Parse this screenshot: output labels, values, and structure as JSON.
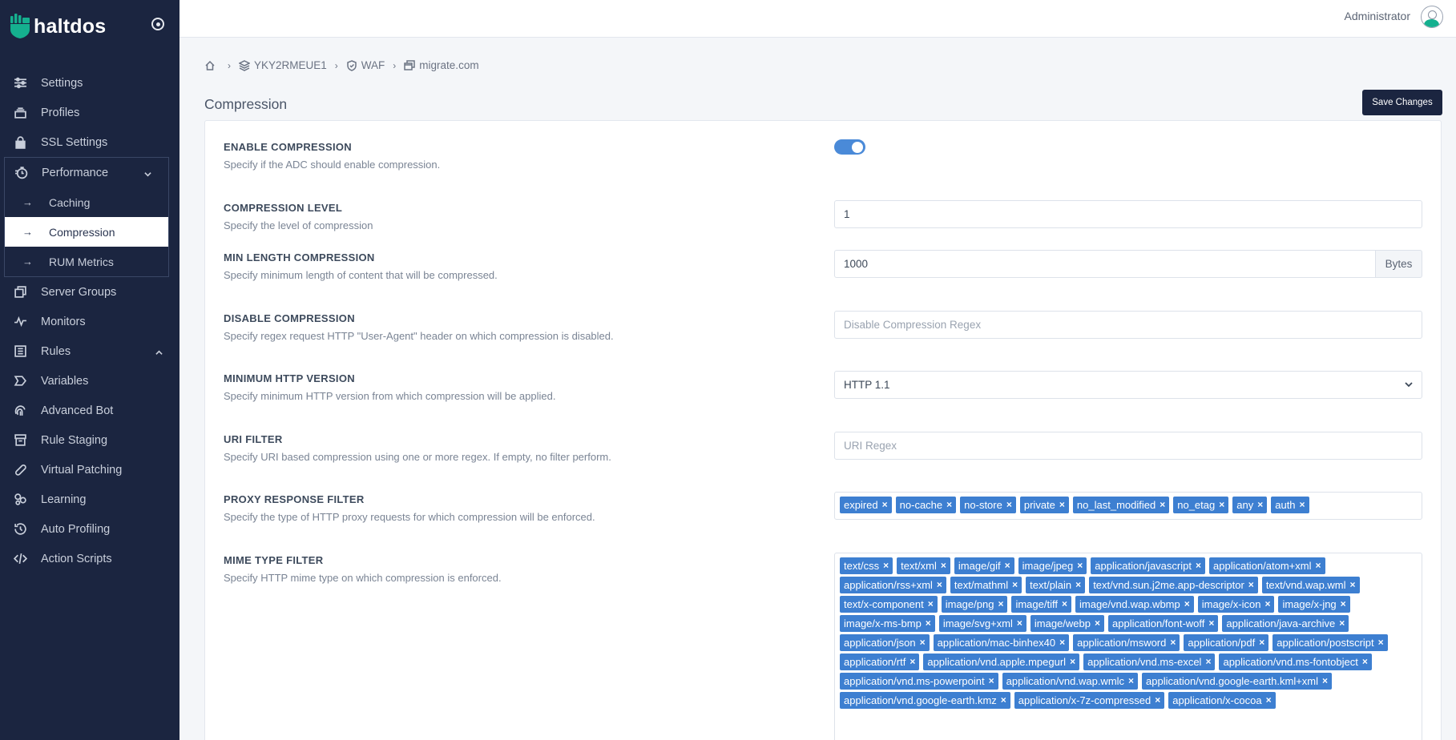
{
  "brand": {
    "name": "haltdos"
  },
  "sidebar": {
    "items": [
      {
        "label": "Settings",
        "icon": "sliders-icon"
      },
      {
        "label": "Profiles",
        "icon": "layers-icon"
      },
      {
        "label": "SSL Settings",
        "icon": "lock-icon"
      }
    ],
    "performance": {
      "label": "Performance",
      "icon": "timer-icon",
      "children": [
        "Caching",
        "Compression",
        "RUM Metrics"
      ],
      "active": "Compression"
    },
    "items_after": [
      {
        "label": "Server Groups",
        "icon": "copy-icon"
      },
      {
        "label": "Monitors",
        "icon": "pulse-icon"
      },
      {
        "label": "Rules",
        "icon": "list-icon"
      },
      {
        "label": "Variables",
        "icon": "tag-icon"
      },
      {
        "label": "Advanced Bot",
        "icon": "fingerprint-icon"
      },
      {
        "label": "Rule Staging",
        "icon": "archive-icon"
      },
      {
        "label": "Virtual Patching",
        "icon": "bandage-icon"
      },
      {
        "label": "Learning",
        "icon": "learning-icon"
      },
      {
        "label": "Auto Profiling",
        "icon": "history-icon"
      },
      {
        "label": "Action Scripts",
        "icon": "code-icon"
      }
    ]
  },
  "topbar": {
    "user": "Administrator"
  },
  "breadcrumb": {
    "node": "YKY2RMEUE1",
    "module": "WAF",
    "site": "migrate.com"
  },
  "page": {
    "title": "Compression",
    "save_label": "Save Changes"
  },
  "settings": {
    "enable": {
      "label": "ENABLE COMPRESSION",
      "desc": "Specify if the ADC should enable compression.",
      "value": true
    },
    "level": {
      "label": "COMPRESSION LEVEL",
      "desc": "Specify the level of compression",
      "value": "1"
    },
    "min_length": {
      "label": "MIN LENGTH COMPRESSION",
      "desc": "Specify minimum length of content that will be compressed.",
      "value": "1000",
      "unit": "Bytes"
    },
    "disable": {
      "label": "DISABLE COMPRESSION",
      "desc": "Specify regex request HTTP \"User-Agent\" header on which compression is disabled.",
      "placeholder": "Disable Compression Regex"
    },
    "http_version": {
      "label": "MINIMUM HTTP VERSION",
      "desc": "Specify minimum HTTP version from which compression will be applied.",
      "value": "HTTP 1.1"
    },
    "uri_filter": {
      "label": "URI FILTER",
      "desc": "Specify URI based compression using one or more regex. If empty, no filter perform.",
      "placeholder": "URI Regex"
    },
    "proxy_filter": {
      "label": "PROXY RESPONSE FILTER",
      "desc": "Specify the type of HTTP proxy requests for which compression will be enforced.",
      "tags": [
        "expired",
        "no-cache",
        "no-store",
        "private",
        "no_last_modified",
        "no_etag",
        "any",
        "auth"
      ]
    },
    "mime_filter": {
      "label": "MIME TYPE FILTER",
      "desc": "Specify HTTP mime type on which compression is enforced.",
      "tags": [
        "text/css",
        "text/xml",
        "image/gif",
        "image/jpeg",
        "application/javascript",
        "application/atom+xml",
        "application/rss+xml",
        "text/mathml",
        "text/plain",
        "text/vnd.sun.j2me.app-descriptor",
        "text/vnd.wap.wml",
        "text/x-component",
        "image/png",
        "image/tiff",
        "image/vnd.wap.wbmp",
        "image/x-icon",
        "image/x-jng",
        "image/x-ms-bmp",
        "image/svg+xml",
        "image/webp",
        "application/font-woff",
        "application/java-archive",
        "application/json",
        "application/mac-binhex40",
        "application/msword",
        "application/pdf",
        "application/postscript",
        "application/rtf",
        "application/vnd.apple.mpegurl",
        "application/vnd.ms-excel",
        "application/vnd.ms-fontobject",
        "application/vnd.ms-powerpoint",
        "application/vnd.wap.wmlc",
        "application/vnd.google-earth.kml+xml",
        "application/vnd.google-earth.kmz",
        "application/x-7z-compressed",
        "application/x-cocoa"
      ]
    }
  }
}
